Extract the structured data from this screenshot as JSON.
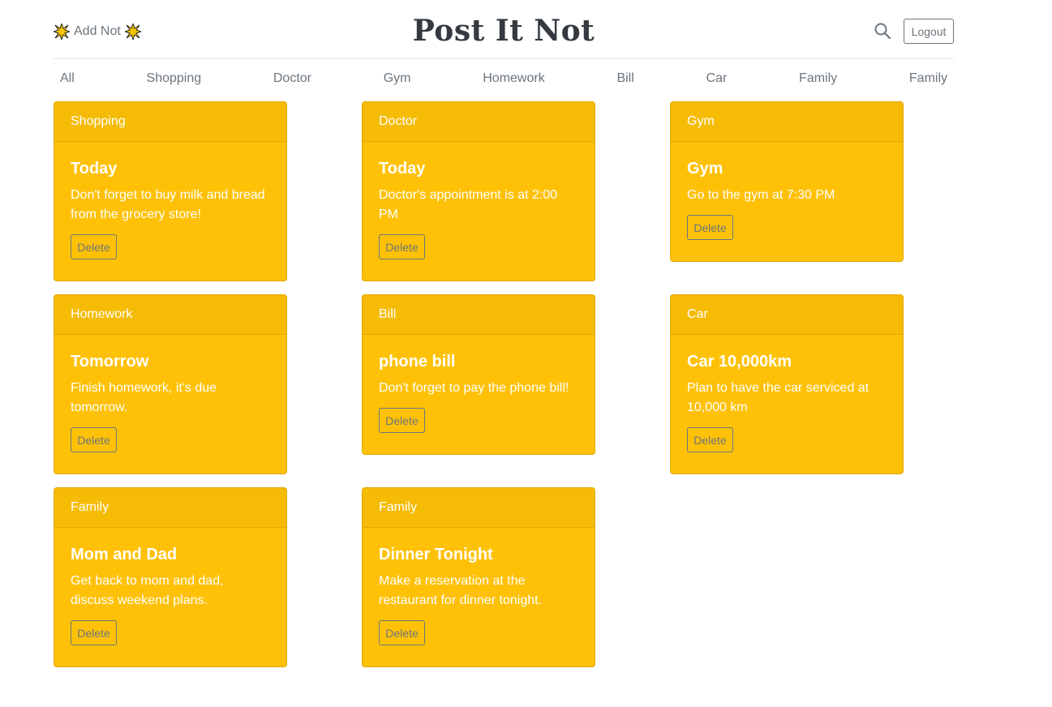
{
  "header": {
    "add_label": "Add Not",
    "title": "Post It Not",
    "logout_label": "Logout"
  },
  "nav": [
    "All",
    "Shopping",
    "Doctor",
    "Gym",
    "Homework",
    "Bill",
    "Car",
    "Family",
    "Family"
  ],
  "notes": [
    {
      "category": "Shopping",
      "title": "Today",
      "text": "Don't forget to buy milk and bread from the grocery store!",
      "delete_label": "Delete"
    },
    {
      "category": "Doctor",
      "title": "Today",
      "text": "Doctor's appointment is at 2:00 PM",
      "delete_label": "Delete"
    },
    {
      "category": "Gym",
      "title": "Gym",
      "text": "Go to the gym at 7:30 PM",
      "delete_label": "Delete"
    },
    {
      "category": "Homework",
      "title": "Tomorrow",
      "text": "Finish homework, it's due tomorrow.",
      "delete_label": "Delete"
    },
    {
      "category": "Bill",
      "title": "phone bill",
      "text": "Don't forget to pay the phone bill!",
      "delete_label": "Delete"
    },
    {
      "category": "Car",
      "title": "Car 10,000km",
      "text": "Plan to have the car serviced at 10,000 km",
      "delete_label": "Delete"
    },
    {
      "category": "Family",
      "title": "Mom and Dad",
      "text": "Get back to mom and dad, discuss weekend plans.",
      "delete_label": "Delete"
    },
    {
      "category": "Family",
      "title": "Dinner Tonight",
      "text": "Make a reservation at the restaurant for dinner tonight.",
      "delete_label": "Delete"
    }
  ],
  "colors": {
    "note": "#ffc107",
    "note_header": "#f5bb05",
    "title": "#343a40",
    "muted": "#6c757d"
  }
}
